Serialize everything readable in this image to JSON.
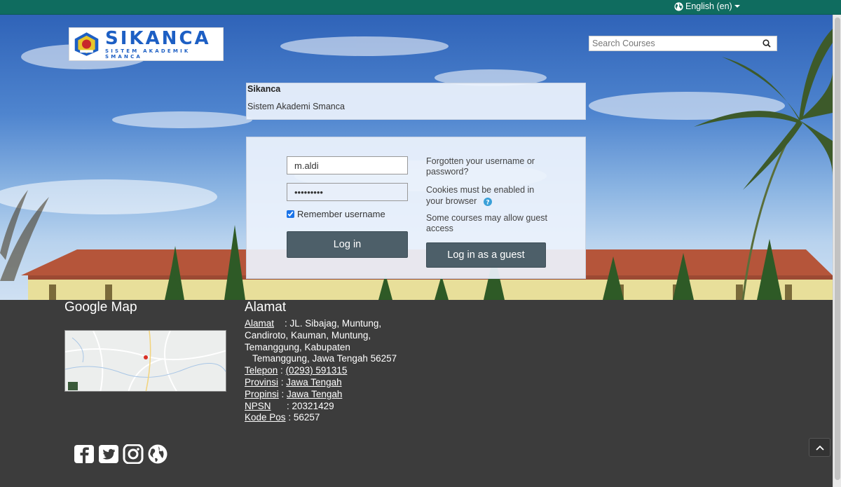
{
  "topbar": {
    "language": "English (en)"
  },
  "logo": {
    "main": "SIKANCA",
    "sub": "SISTEM AKADEMIK SMANCA"
  },
  "search": {
    "placeholder": "Search Courses"
  },
  "site": {
    "name": "Sikanca",
    "description": "Sistem Akademi Smanca"
  },
  "login": {
    "username_value": "m.aldi",
    "password_value": "•••••••••",
    "remember_label": "Remember username",
    "login_button": "Log in",
    "forgot_link": "Forgotten your username or password?",
    "cookies_text": "Cookies must be enabled in your browser",
    "guest_text": "Some courses may allow guest access",
    "guest_button": "Log in as a guest"
  },
  "footer": {
    "map_title": "Google Map",
    "address_title": "Alamat",
    "alamat_key": "Alamat",
    "alamat_line1": ": JL. Sibajag, Muntung,",
    "alamat_line2": "Candiroto, Kauman, Muntung,",
    "alamat_line3": "Temanggung, Kabupaten",
    "alamat_line4": "Temanggung, Jawa Tengah 56257",
    "telepon_key": "Telepon",
    "telepon_sep": " : ",
    "telepon_value": "(0293) 591315",
    "provinsi_key": "Provinsi",
    "provinsi_sep": " : ",
    "provinsi_value": "Jawa Tengah",
    "propinsi_key": "Propinsi",
    "propinsi_sep": " : ",
    "propinsi_value": "Jawa Tengah",
    "npsn_key": "NPSN",
    "npsn_value": ": 20321429",
    "kodepos_key": "Kode Pos",
    "kodepos_value": ": 56257"
  },
  "social": [
    "facebook-icon",
    "twitter-icon",
    "instagram-icon",
    "globe-icon"
  ],
  "colors": {
    "topbar": "#0f6c5f",
    "footer": "#3c3c3c",
    "button": "#4d5f69",
    "logo_blue": "#1d5fc4"
  }
}
